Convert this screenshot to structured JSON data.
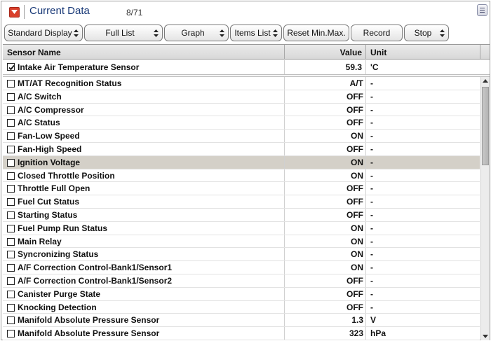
{
  "header": {
    "title": "Current Data",
    "page_count": "8/71"
  },
  "toolbar": {
    "buttons": [
      {
        "label": "Standard Display",
        "has_arrow": true
      },
      {
        "label": "Full List",
        "has_arrow": true
      },
      {
        "label": "Graph",
        "has_arrow": true
      },
      {
        "label": "Items List",
        "has_arrow": true
      },
      {
        "label": "Reset Min.Max.",
        "has_arrow": false
      },
      {
        "label": "Record",
        "has_arrow": false
      },
      {
        "label": "Stop",
        "has_arrow": true
      }
    ]
  },
  "table": {
    "columns": {
      "name": "Sensor Name",
      "value": "Value",
      "unit": "Unit"
    },
    "fixed_row": {
      "name": "Intake Air Temperature Sensor",
      "value": "59.3",
      "unit": "'C",
      "checked": true
    },
    "rows": [
      {
        "name": "MT/AT Recognition Status",
        "value": "A/T",
        "unit": "-"
      },
      {
        "name": "A/C Switch",
        "value": "OFF",
        "unit": "-"
      },
      {
        "name": "A/C Compressor",
        "value": "OFF",
        "unit": "-"
      },
      {
        "name": "A/C Status",
        "value": "OFF",
        "unit": "-"
      },
      {
        "name": "Fan-Low Speed",
        "value": "ON",
        "unit": "-"
      },
      {
        "name": "Fan-High Speed",
        "value": "OFF",
        "unit": "-"
      },
      {
        "name": "Ignition Voltage",
        "value": "ON",
        "unit": "-",
        "selected": true
      },
      {
        "name": "Closed Throttle Position",
        "value": "ON",
        "unit": "-"
      },
      {
        "name": "Throttle Full Open",
        "value": "OFF",
        "unit": "-"
      },
      {
        "name": "Fuel Cut Status",
        "value": "OFF",
        "unit": "-"
      },
      {
        "name": "Starting Status",
        "value": "OFF",
        "unit": "-"
      },
      {
        "name": "Fuel Pump Run Status",
        "value": "ON",
        "unit": "-"
      },
      {
        "name": "Main Relay",
        "value": "ON",
        "unit": "-"
      },
      {
        "name": "Syncronizing Status",
        "value": "ON",
        "unit": "-"
      },
      {
        "name": "A/F Correction Control-Bank1/Sensor1",
        "value": "ON",
        "unit": "-"
      },
      {
        "name": "A/F Correction Control-Bank1/Sensor2",
        "value": "OFF",
        "unit": "-"
      },
      {
        "name": "Canister Purge State",
        "value": "OFF",
        "unit": "-"
      },
      {
        "name": "Knocking Detection",
        "value": "OFF",
        "unit": "-"
      },
      {
        "name": "Manifold Absolute Pressure Sensor",
        "value": "1.3",
        "unit": "V"
      },
      {
        "name": "Manifold Absolute Pressure Sensor",
        "value": "323",
        "unit": "hPa"
      }
    ]
  },
  "scrollbar": {
    "position": 0.0
  }
}
